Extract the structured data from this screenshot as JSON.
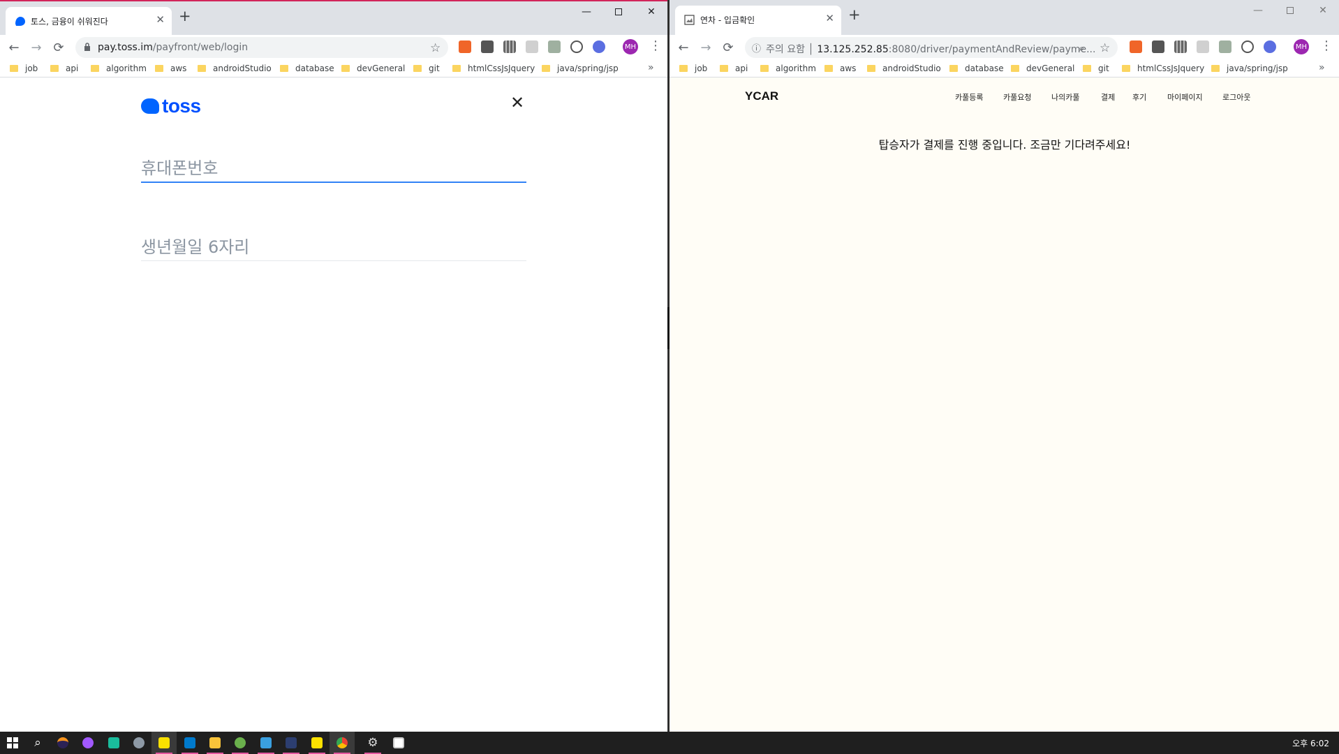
{
  "left_window": {
    "tab": {
      "title": "토스, 금융이 쉬워진다",
      "favicon": "toss-icon",
      "favicon_color": "#0064ff"
    },
    "address": {
      "host": "pay.toss.im",
      "path": "/payfront/web/login",
      "secure_icon": "lock-icon"
    },
    "bookmarks": [
      "job",
      "api",
      "algorithm",
      "aws",
      "androidStudio",
      "database",
      "devGeneral",
      "git",
      "htmlCssJsJquery",
      "java/spring/jsp"
    ],
    "page": {
      "logo_text": "toss",
      "phone_placeholder": "휴대폰번호",
      "birth_placeholder": "생년월일 6자리"
    }
  },
  "right_window": {
    "tab": {
      "title": "연차 - 입금확인",
      "favicon": "page-icon"
    },
    "address": {
      "security_label": "주의 요함",
      "host": "13.125.252.85",
      "path": ":8080/driver/paymentAndReview/payme..."
    },
    "bookmarks": [
      "job",
      "api",
      "algorithm",
      "aws",
      "androidStudio",
      "database",
      "devGeneral",
      "git",
      "htmlCssJsJquery",
      "java/spring/jsp"
    ],
    "page": {
      "brand": "YCAR",
      "nav": [
        "카풀등록",
        "카풀요청",
        "나의카풀",
        "결제",
        "후기",
        "마이페이지",
        "로그아웃"
      ],
      "message": "탑승자가 결제를 진행 중입니다. 조금만 기다려주세요!"
    }
  },
  "browser": {
    "profile_initials": "MH",
    "profile_color": "#9c27b0",
    "new_tab_symbol": "+",
    "overflow_symbol": "»"
  },
  "taskbar": {
    "icons": [
      "windows-start-icon",
      "search-icon",
      "eclipse-icon",
      "app-circle-icon",
      "app-star-icon",
      "app-pen-icon",
      "kakaotalk-icon",
      "vscode-icon",
      "file-explorer-icon",
      "app-leaf-icon",
      "app-square-icon",
      "app-edit-icon",
      "sticky-notes-icon",
      "chrome-icon",
      "settings-icon",
      "photos-icon"
    ],
    "clock": "오후 6:02"
  }
}
